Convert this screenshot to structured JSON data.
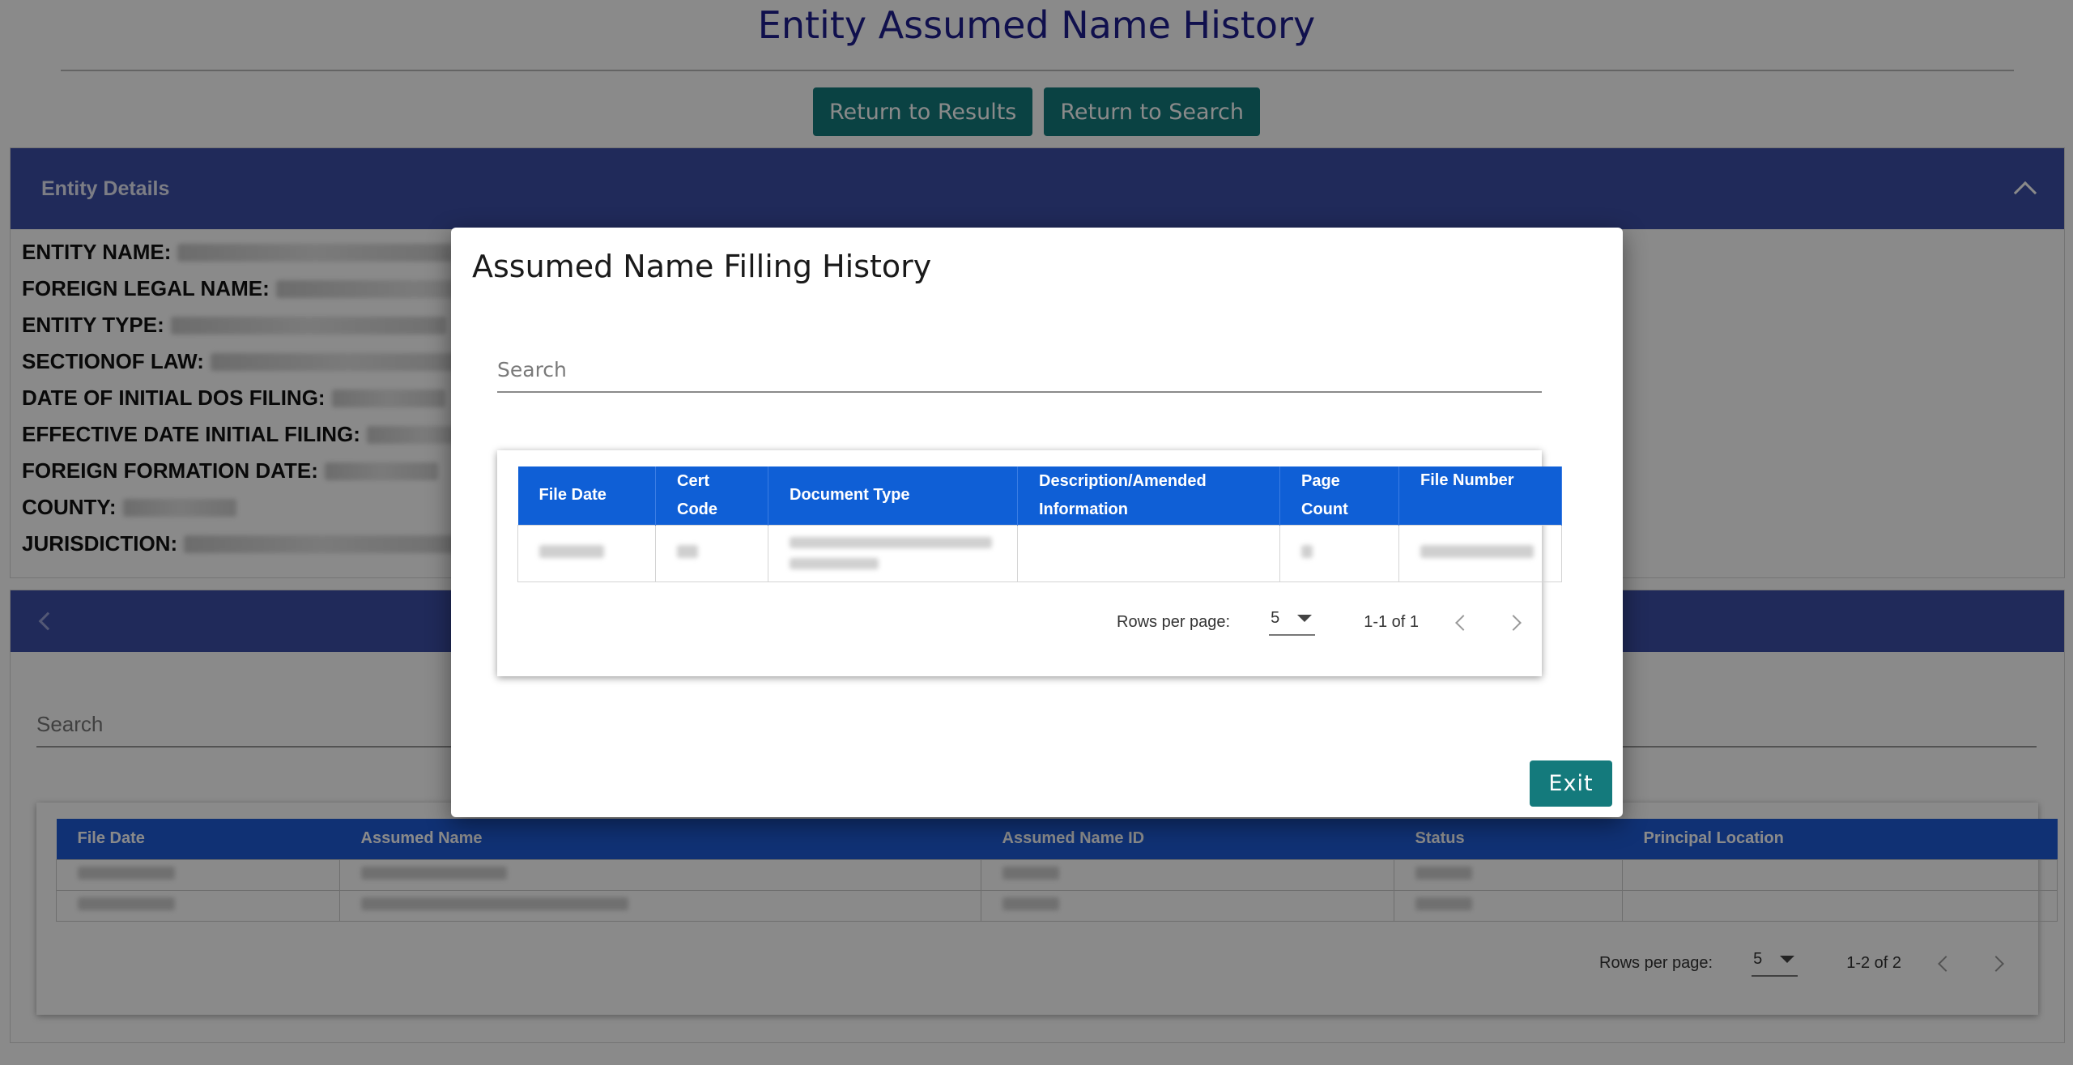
{
  "page": {
    "title": "Entity Assumed Name History",
    "buttons": {
      "return_results": "Return to Results",
      "return_search": "Return to Search"
    }
  },
  "entity_details": {
    "header": "Entity Details",
    "icons": {
      "collapse": "chevron-up-icon"
    },
    "fields": [
      {
        "label": "ENTITY NAME:"
      },
      {
        "label": "FOREIGN LEGAL NAME:"
      },
      {
        "label": "ENTITY TYPE:"
      },
      {
        "label": "SECTIONOF LAW:"
      },
      {
        "label": "DATE OF INITIAL DOS FILING:"
      },
      {
        "label": "EFFECTIVE DATE INITIAL FILING:"
      },
      {
        "label": "FOREIGN FORMATION DATE:"
      },
      {
        "label": "COUNTY:"
      },
      {
        "label": "JURISDICTION:"
      }
    ]
  },
  "assumed_names": {
    "icons": {
      "back": "chevron-left-icon"
    },
    "search_placeholder": "Search",
    "columns": [
      "File Date",
      "Assumed Name",
      "Assumed Name ID",
      "Status",
      "Principal Location"
    ],
    "rows_per_page_label": "Rows per page:",
    "rows_per_page": "5",
    "range": "1-2 of 2"
  },
  "modal": {
    "title": "Assumed Name Filling History",
    "search_placeholder": "Search",
    "columns": {
      "file_date": "File Date",
      "cert_code_1": "Cert",
      "cert_code_2": "Code",
      "document_type": "Document Type",
      "description_1": "Description/Amended",
      "description_2": "Information",
      "page_count_1": "Page",
      "page_count_2": "Count",
      "file_number": "File Number"
    },
    "rows_per_page_label": "Rows per page:",
    "rows_per_page": "5",
    "range": "1-1 of 1",
    "exit_label": "Exit"
  }
}
